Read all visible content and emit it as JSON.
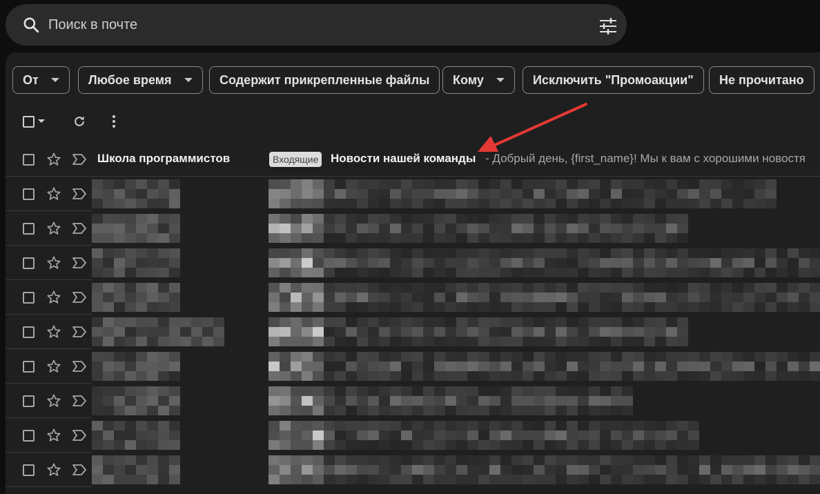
{
  "search": {
    "placeholder": "Поиск в почте"
  },
  "filters": [
    {
      "label": "От",
      "dropdown": true
    },
    {
      "label": "Любое время",
      "dropdown": true
    },
    {
      "label": "Содержит прикрепленные файлы",
      "dropdown": false
    },
    {
      "label": "Кому",
      "dropdown": true
    },
    {
      "label": "Исключить \"Промоакции\"",
      "dropdown": false
    },
    {
      "label": "Не прочитано",
      "dropdown": false
    }
  ],
  "toolbar": {
    "icons": [
      "checkbox-icon",
      "caret-down-icon",
      "refresh-icon",
      "more-vert-icon"
    ]
  },
  "first_email": {
    "sender": "Школа программистов",
    "label": "Входящие",
    "subject": "Новости нашей команды",
    "snippet": "- Добрый день, {first_name}! Мы к вам с хорошими новостя"
  },
  "colors": {
    "background": "#0e0e0e",
    "panel": "#1f1f1f",
    "searchbar": "#2b2b2b",
    "arrow": "#e53935"
  }
}
